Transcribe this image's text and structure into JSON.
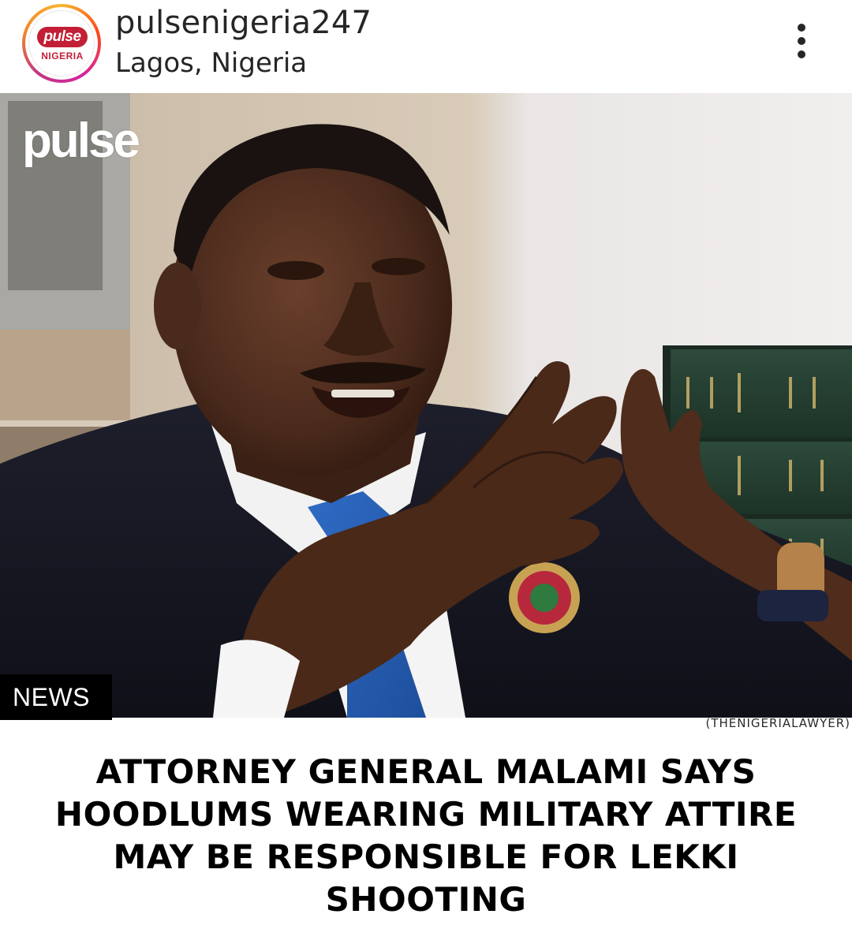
{
  "post": {
    "username": "pulsenigeria247",
    "location": "Lagos, Nigeria",
    "avatar": {
      "logo_text": "pulse",
      "country_text": "NIGERIA"
    },
    "more_icon": "more-vertical-icon"
  },
  "image": {
    "watermark": "pulse",
    "category": "NEWS",
    "credit": "(THENIGERIALAWYER)"
  },
  "headline": "ATTORNEY GENERAL MALAMI SAYS HOODLUMS WEARING MILITARY ATTIRE MAY BE RESPONSIBLE FOR LEKKI SHOOTING",
  "colors": {
    "brand": "#c21e35",
    "text": "#262626",
    "tag_bg": "#000000"
  }
}
